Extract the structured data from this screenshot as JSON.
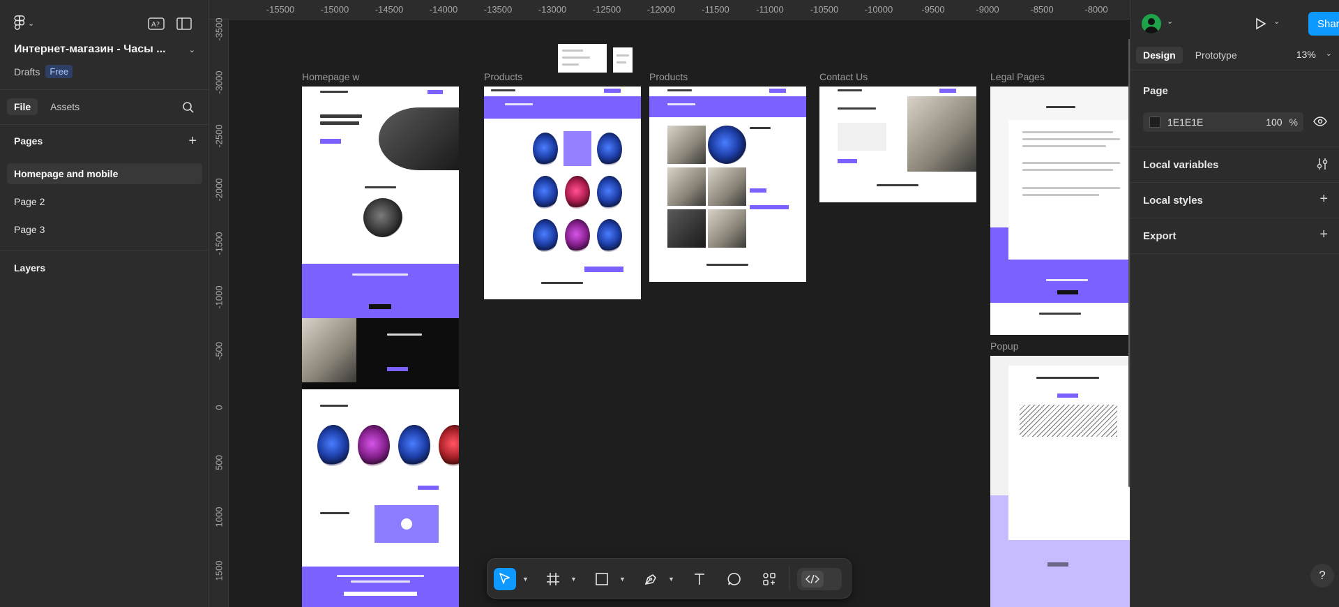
{
  "file": {
    "title": "Интернет-магазин - Часы ...",
    "location": "Drafts",
    "plan_badge": "Free"
  },
  "left_panel": {
    "tabs": [
      {
        "label": "File",
        "active": true
      },
      {
        "label": "Assets",
        "active": false
      }
    ],
    "pages_title": "Pages",
    "pages": [
      {
        "label": "Homepage and mobile",
        "active": true
      },
      {
        "label": "Page 2",
        "active": false
      },
      {
        "label": "Page 3",
        "active": false
      }
    ],
    "layers_title": "Layers"
  },
  "rulers": {
    "top": [
      "-15500",
      "-15000",
      "-14500",
      "-14000",
      "-13500",
      "-13000",
      "-12500",
      "-12000",
      "-11500",
      "-11000",
      "-10500",
      "-10000",
      "-9500",
      "-9000",
      "-8500",
      "-8000"
    ],
    "left": [
      "-3500",
      "-3000",
      "-2500",
      "-2000",
      "-1500",
      "-1000",
      "-500",
      "0",
      "500",
      "1000",
      "1500"
    ]
  },
  "canvas": {
    "background": "#1E1E1E",
    "accent": "#7B61FF",
    "frames": [
      {
        "label": "Homepage w"
      },
      {
        "label": "Products"
      },
      {
        "label": "Products"
      },
      {
        "label": "Contact Us"
      },
      {
        "label": "Legal Pages"
      },
      {
        "label": "Popup"
      }
    ]
  },
  "toolbar": {
    "tools": [
      "move-tool",
      "frame-tool",
      "rectangle-tool",
      "pen-tool",
      "text-tool",
      "comment-tool",
      "actions-tool",
      "dev-mode-toggle"
    ],
    "active_tool": "move-tool",
    "active_color": "#0D99FF"
  },
  "right_panel": {
    "share_label": "Share",
    "tabs": [
      {
        "label": "Design",
        "active": true
      },
      {
        "label": "Prototype",
        "active": false
      }
    ],
    "zoom": "13%",
    "page_section": {
      "title": "Page",
      "background_hex": "1E1E1E",
      "opacity": "100",
      "percent_sign": "%"
    },
    "local_variables": "Local variables",
    "local_styles": "Local styles",
    "export": "Export",
    "help": "?"
  }
}
